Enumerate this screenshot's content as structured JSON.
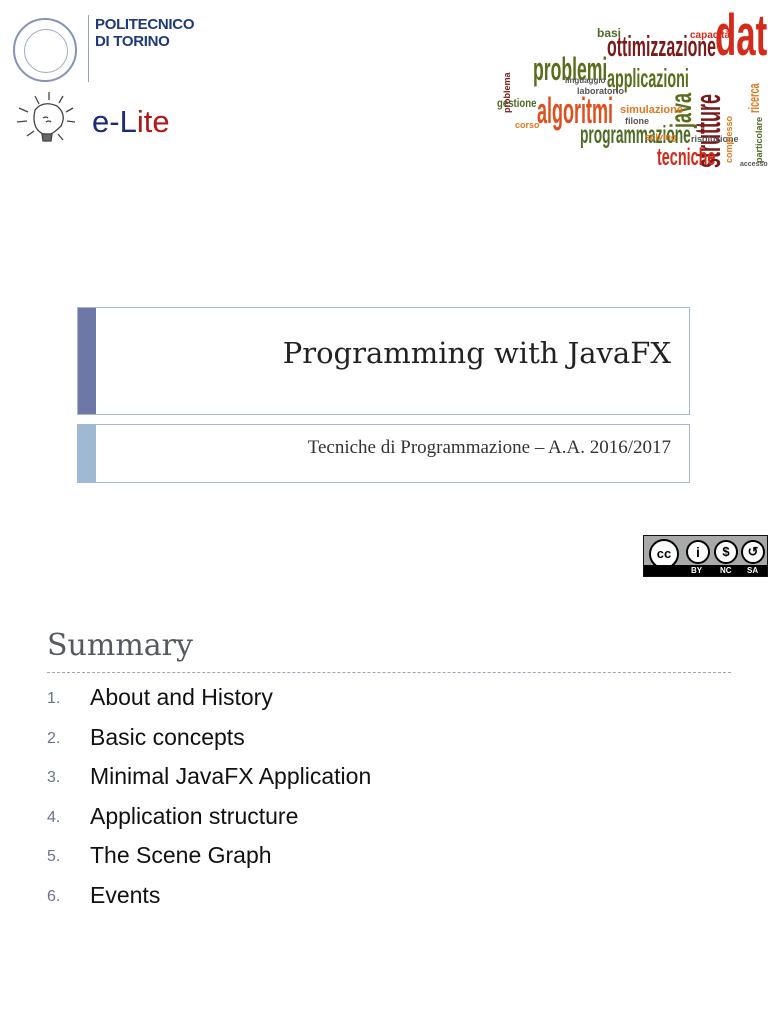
{
  "header": {
    "institution": "POLITECNICO DI TORINO",
    "institution_line1": "POLITECNICO",
    "institution_line2": "DI TORINO",
    "group_logo": {
      "e": "e-",
      "l": "L",
      "ite": "ite"
    }
  },
  "word_cloud": {
    "words": [
      "dati",
      "ottimizzazione",
      "problemi",
      "applicazioni",
      "algoritmi",
      "java",
      "strutture",
      "programmazione",
      "tecniche",
      "simulazione",
      "gestione",
      "basi",
      "ricerca",
      "capacità",
      "risoluzione",
      "laboratorio",
      "complesso",
      "problema",
      "solving",
      "corso",
      "filone",
      "particolare",
      "accesso",
      "linguaggio"
    ],
    "colors": {
      "red": "#d42a1a",
      "dark_red": "#7a1a1a",
      "olive": "#5a6e1a",
      "orange": "#e0781e",
      "green": "#4e6b24"
    }
  },
  "title": "Programming with JavaFX",
  "subtitle": "Tecniche di Programmazione – A.A. 2016/2017",
  "license": {
    "cc": "cc",
    "labels": [
      "BY",
      "NC",
      "SA"
    ]
  },
  "summary": {
    "heading": "Summary",
    "items": [
      {
        "num": "1.",
        "text": "About and History"
      },
      {
        "num": "2.",
        "text": "Basic concepts"
      },
      {
        "num": "3.",
        "text": "Minimal JavaFX Application"
      },
      {
        "num": "4.",
        "text": "Application structure"
      },
      {
        "num": "5.",
        "text": "The Scene Graph"
      },
      {
        "num": "6.",
        "text": "Events"
      }
    ]
  }
}
